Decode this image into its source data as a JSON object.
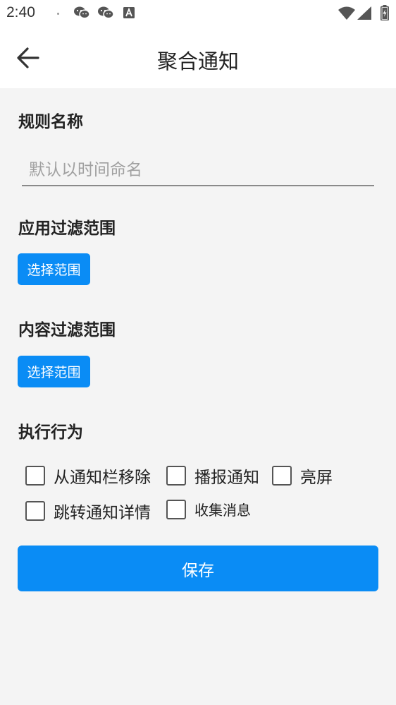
{
  "status_bar": {
    "time": "2:40",
    "icons": [
      "wechat-icon",
      "wechat-icon",
      "text-a-icon",
      "wifi-icon",
      "cell-signal-icon",
      "battery-icon"
    ]
  },
  "app_bar": {
    "title": "聚合通知",
    "back_icon": "back-arrow-icon"
  },
  "form": {
    "rule_name_label": "规则名称",
    "rule_name_placeholder": "默认以时间命名",
    "rule_name_value": "",
    "app_filter_label": "应用过滤范围",
    "app_filter_button": "选择范围",
    "content_filter_label": "内容过滤范围",
    "content_filter_button": "选择范围",
    "actions_label": "执行行为",
    "actions": [
      {
        "label": "从通知栏移除",
        "checked": false
      },
      {
        "label": "播报通知",
        "checked": false
      },
      {
        "label": "亮屏",
        "checked": false
      },
      {
        "label": "跳转通知详情",
        "checked": false
      },
      {
        "label": "收集消息",
        "checked": false
      }
    ],
    "save_button": "保存"
  },
  "colors": {
    "accent": "#0a8cf5",
    "background": "#f4f4f4",
    "bar": "#ffffff"
  }
}
